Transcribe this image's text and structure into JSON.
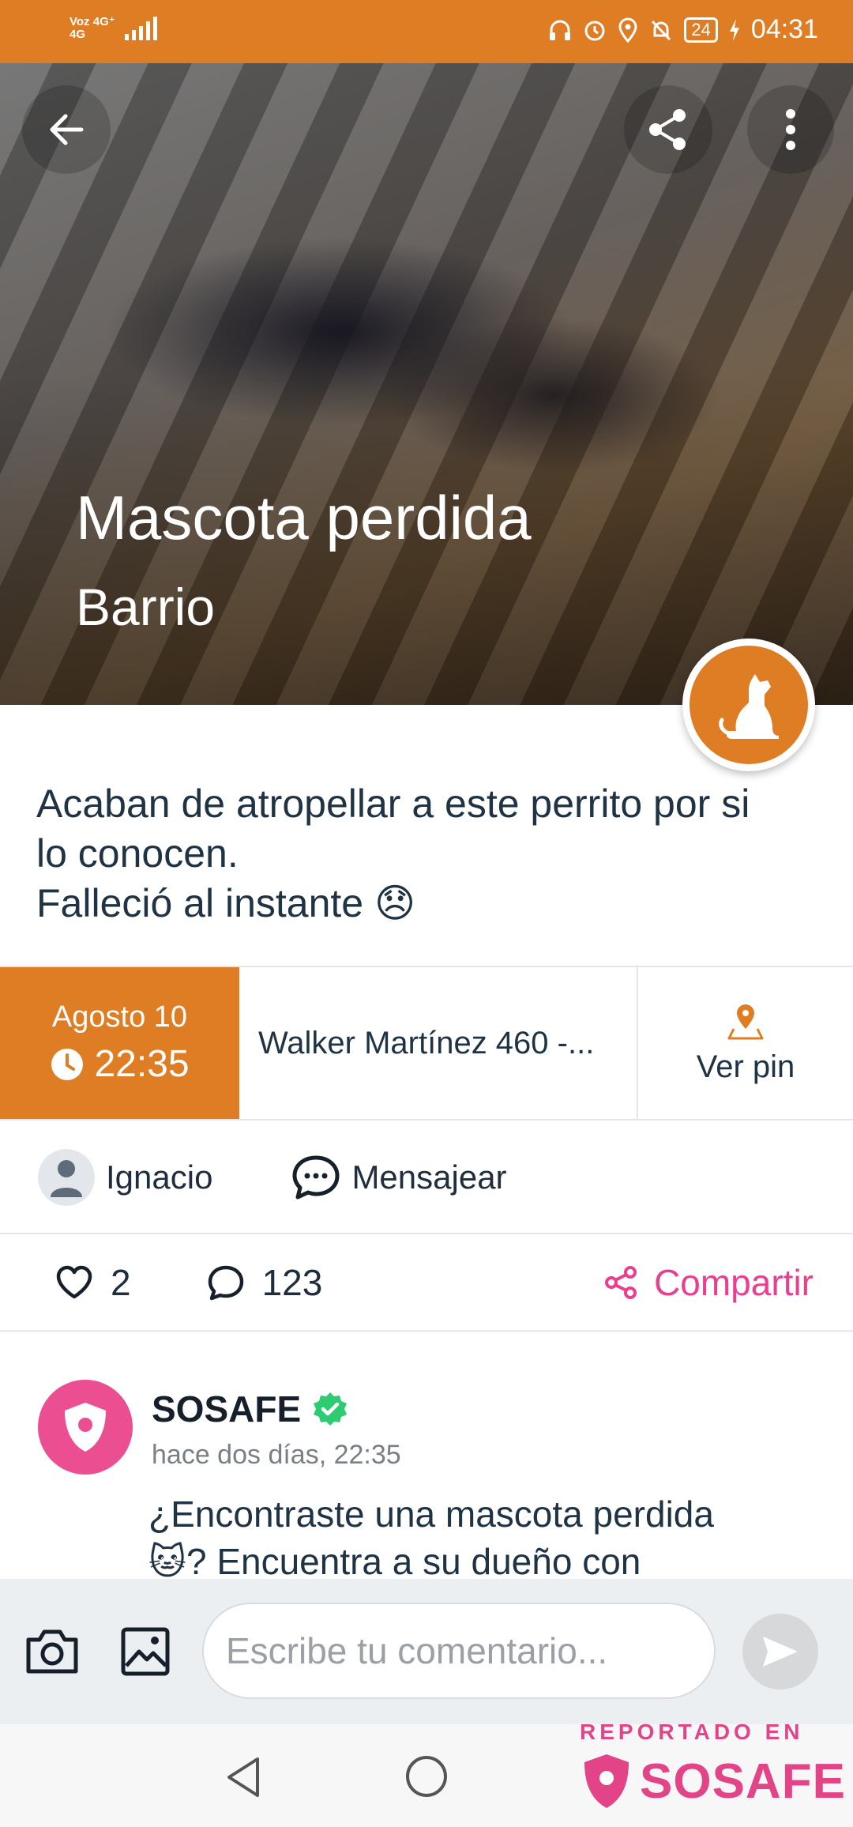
{
  "status_bar": {
    "network_top": "Voz 4G⁺",
    "network_bottom": "4G",
    "battery": "24",
    "time": "04:31"
  },
  "hero": {
    "title": "Mascota perdida",
    "subtitle": "Barrio"
  },
  "post": {
    "description_lines": [
      "Acaban de atropellar a este perrito por si",
      "lo conocen.",
      "Falleció al instante 😞"
    ],
    "date": "Agosto 10",
    "time": "22:35",
    "address": "Walker Martínez  460 -...",
    "pin_label": "Ver pin",
    "author": "Ignacio",
    "message_label": "Mensajear",
    "likes": "2",
    "comments": "123",
    "share_label": "Compartir"
  },
  "comment": {
    "author": "SOSAFE",
    "time": "hace dos días, 22:35",
    "text_line1": "¿Encontraste una mascota perdida",
    "text_line2": "🐱? Encuentra a su dueño con"
  },
  "input": {
    "placeholder": "Escribe tu comentario..."
  },
  "watermark": {
    "top": "REPORTADO EN",
    "brand": "SOSAFE"
  },
  "colors": {
    "accent": "#df7d25",
    "brand_pink": "#ea3f8e",
    "verified": "#2ecc71"
  }
}
